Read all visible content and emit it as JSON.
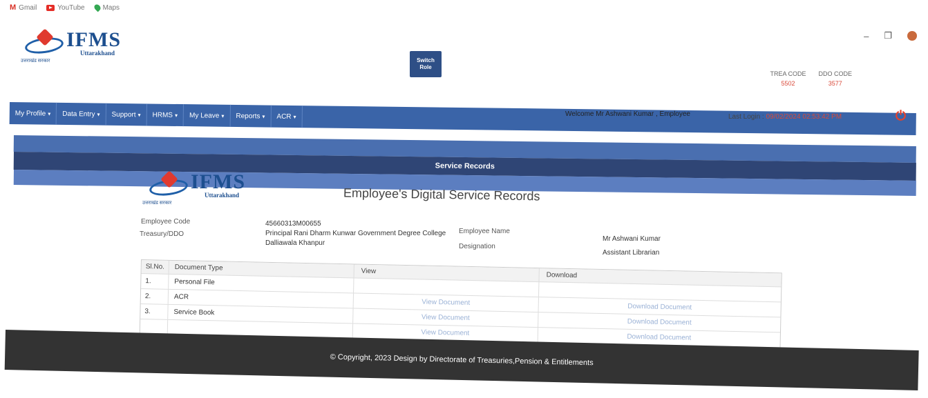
{
  "browser": {
    "bookmarks": [
      {
        "icon": "gmail-icon",
        "label": "Gmail"
      },
      {
        "icon": "youtube-icon",
        "label": "YouTube"
      },
      {
        "icon": "maps-icon",
        "label": "Maps"
      }
    ]
  },
  "header": {
    "logo_text": "IFMS",
    "logo_sub": "Uttarakhand",
    "logo_hindi": "उत्तराखंड सरकार",
    "switch_role": "Switch Role",
    "treasury_code_label": "TREA CODE",
    "treasury_code_value": "5502",
    "ddo_code_label": "DDO CODE",
    "ddo_code_value": "3577"
  },
  "nav": {
    "items": [
      "My Profile",
      "Data Entry",
      "Support",
      "HRMS",
      "My Leave",
      "Reports",
      "ACR"
    ],
    "welcome": "Welcome Mr Ashwani Kumar , Employee",
    "last_login_label": "Last Login :",
    "last_login_value": "09/02/2024 02:53:42 PM"
  },
  "banner_title": "Service Records",
  "document": {
    "title": "Employee's Digital Service Records",
    "employee_code_label": "Employee Code",
    "employee_code_value": "45660313M00655",
    "treasury_ddo_label": "Treasury/DDO",
    "treasury_ddo_value": "Principal Rani Dharm Kunwar Government Degree College Dalliawala Khanpur",
    "employee_name_label": "Employee Name",
    "employee_name_value": "Mr Ashwani Kumar",
    "designation_label": "Designation",
    "designation_value": "Assistant Librarian"
  },
  "table": {
    "headers": [
      "Sl.No.",
      "Document Type",
      "View",
      "Download"
    ],
    "rows": [
      {
        "sl": "1.",
        "type": "Personal File",
        "view": "",
        "download": ""
      },
      {
        "sl": "2.",
        "type": "ACR",
        "view": "View Document",
        "download": "Download Document"
      },
      {
        "sl": "3.",
        "type": "Service Book",
        "view": "View Document",
        "download": "Download Document"
      },
      {
        "sl": "",
        "type": "",
        "view": "View Document",
        "download": "Download Document"
      }
    ]
  },
  "footer": {
    "text": "© Copyright, 2023 Design by Directorate of Treasuries,Pension & Entitlements"
  },
  "colors": {
    "nav_blue": "#3a64a8",
    "banner_dark": "#2f4575",
    "footer": "#333333",
    "accent_red": "#d94a3a"
  }
}
